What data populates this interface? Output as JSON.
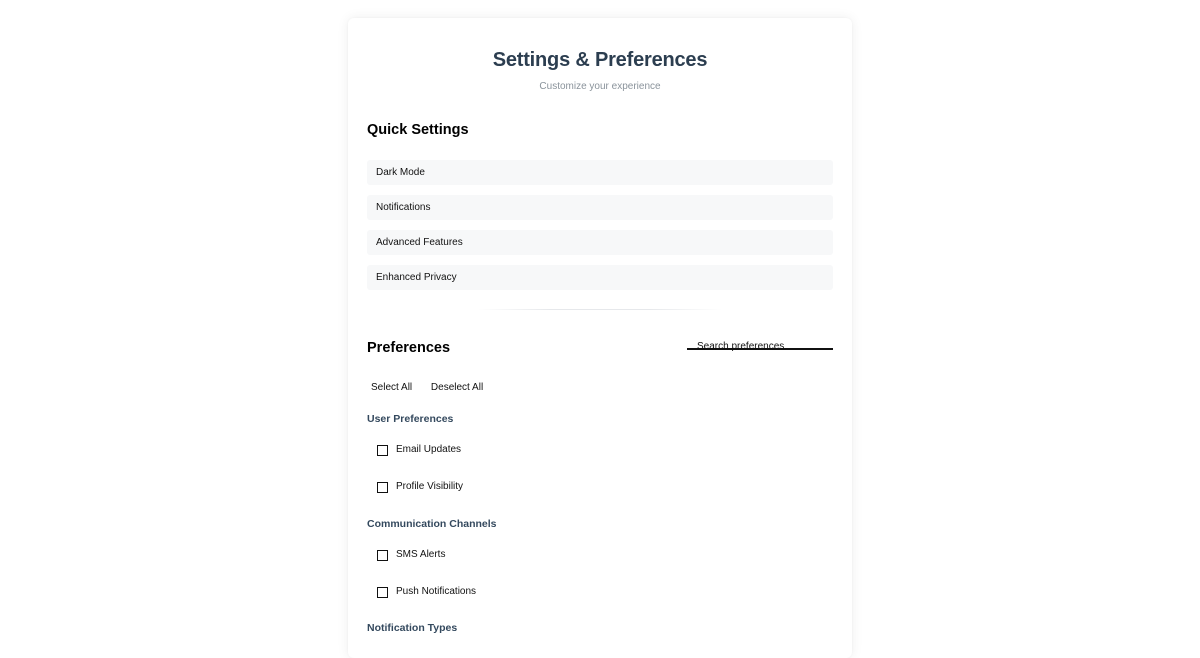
{
  "header": {
    "title": "Settings & Preferences",
    "subtitle": "Customize your experience"
  },
  "quick_settings": {
    "title": "Quick Settings",
    "items": [
      {
        "label": "Dark Mode"
      },
      {
        "label": "Notifications"
      },
      {
        "label": "Advanced Features"
      },
      {
        "label": "Enhanced Privacy"
      }
    ]
  },
  "preferences": {
    "title": "Preferences",
    "search": {
      "placeholder": "Search preferences",
      "value": ""
    },
    "select_all_label": "Select All",
    "deselect_all_label": "Deselect All",
    "groups": [
      {
        "title": "User Preferences",
        "options": [
          {
            "label": "Email Updates",
            "checked": false
          },
          {
            "label": "Profile Visibility",
            "checked": false
          }
        ]
      },
      {
        "title": "Communication Channels",
        "options": [
          {
            "label": "SMS Alerts",
            "checked": false
          },
          {
            "label": "Push Notifications",
            "checked": false
          }
        ]
      },
      {
        "title": "Notification Types",
        "options": []
      }
    ]
  },
  "colors": {
    "title": "#2c3e50",
    "group_title": "#34495e",
    "subtitle": "#8a939b",
    "quick_item_bg": "#f7f8f9"
  }
}
